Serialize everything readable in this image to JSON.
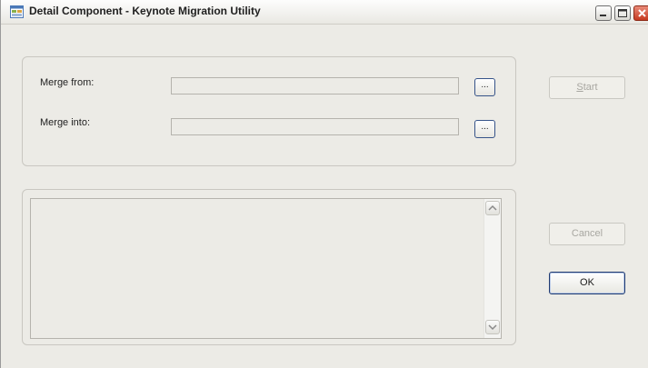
{
  "window": {
    "title": "Detail Component - Keynote Migration Utility",
    "icon": "app-window-icon"
  },
  "caption_buttons": [
    "minimize-icon",
    "maximize-icon",
    "close-icon"
  ],
  "merge": {
    "from_label": "Merge from:",
    "from_value": "",
    "into_label": "Merge into:",
    "into_value": "",
    "browse_label": "..."
  },
  "log": {
    "text": ""
  },
  "buttons": {
    "start_prefix": "S",
    "start_rest": "tart",
    "cancel": "Cancel",
    "ok": "OK"
  },
  "colors": {
    "window_bg": "#ecebe6",
    "close_button": "#c53a20",
    "default_button_border": "#1f3a70",
    "disabled_text": "#a8a7a1"
  }
}
